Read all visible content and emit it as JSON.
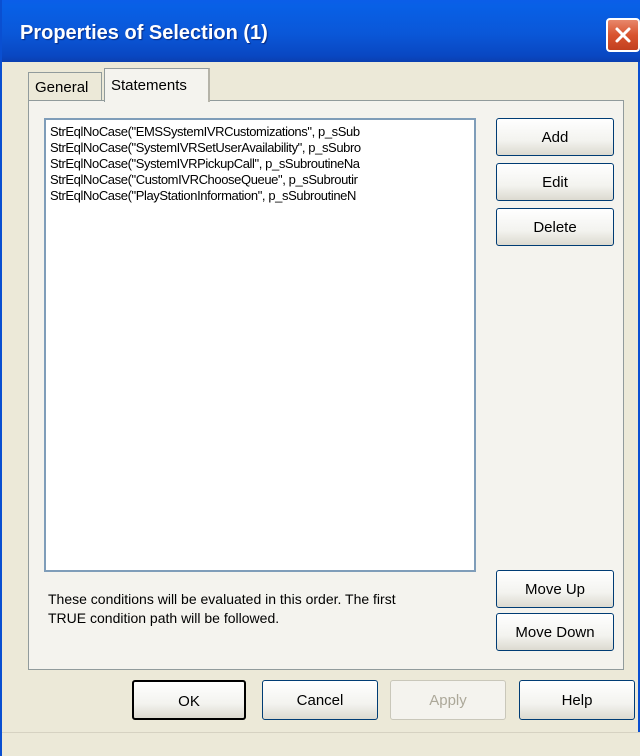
{
  "window": {
    "title": "Properties of Selection (1)"
  },
  "tabs": [
    {
      "label": "General",
      "active": false
    },
    {
      "label": "Statements",
      "active": true
    }
  ],
  "statements": {
    "items": [
      "StrEqlNoCase(\"EMSSystemIVRCustomizations\", p_sSub",
      "StrEqlNoCase(\"SystemIVRSetUserAvailability\", p_sSubro",
      "StrEqlNoCase(\"SystemIVRPickupCall\", p_sSubroutineNa",
      "StrEqlNoCase(\"CustomIVRChooseQueue\", p_sSubroutir",
      "StrEqlNoCase(\"PlayStationInformation\", p_sSubroutineN"
    ],
    "add_label": "Add",
    "edit_label": "Edit",
    "delete_label": "Delete",
    "move_up_label": "Move Up",
    "move_down_label": "Move Down",
    "note_line1": "These conditions will be evaluated in this order.  The first",
    "note_line2": "TRUE condition path will be followed."
  },
  "footer": {
    "ok_label": "OK",
    "cancel_label": "Cancel",
    "apply_label": "Apply",
    "help_label": "Help"
  },
  "icons": {
    "close": "close-icon"
  },
  "colors": {
    "titlebar": "#0a57d8",
    "close_button": "#d9542f",
    "dialog_background": "#ece9d8"
  }
}
